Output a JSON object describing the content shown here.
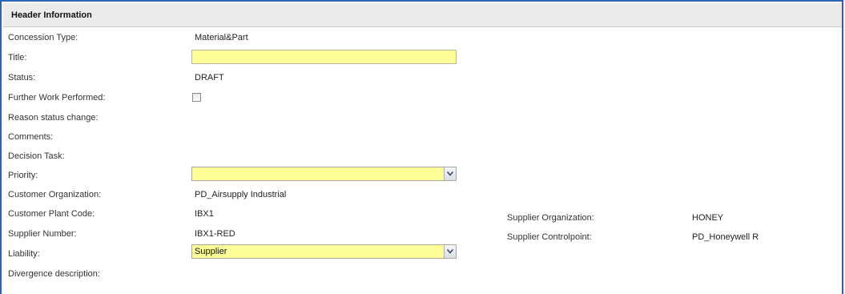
{
  "header": {
    "title": "Header Information"
  },
  "fields": {
    "concession_type": {
      "label": "Concession Type:",
      "value": "Material&Part"
    },
    "title": {
      "label": "Title:",
      "value": ""
    },
    "status": {
      "label": "Status:",
      "value": "DRAFT"
    },
    "further_work": {
      "label": "Further Work Performed:",
      "checked": false
    },
    "reason_status_change": {
      "label": "Reason status change:"
    },
    "comments": {
      "label": "Comments:"
    },
    "decision_task": {
      "label": "Decision Task:"
    },
    "priority": {
      "label": "Priority:",
      "value": ""
    },
    "customer_organization": {
      "label": "Customer Organization:",
      "value": "PD_Airsupply Industrial"
    },
    "customer_plant_code": {
      "label": "Customer Plant Code:",
      "value": "IBX1"
    },
    "supplier_number": {
      "label": "Supplier Number:",
      "value": "IBX1-RED"
    },
    "liability": {
      "label": "Liability:",
      "value": "Supplier"
    },
    "divergence_description": {
      "label": "Divergence description:"
    },
    "supplier_organization": {
      "label": "Supplier Organization:",
      "value": "HONEY"
    },
    "supplier_controlpoint": {
      "label": "Supplier Controlpoint:",
      "value": "PD_Honeywell R"
    }
  },
  "colors": {
    "required_field": "#ffff99",
    "frame_border": "#2b64b6",
    "header_background": "#ebebeb"
  },
  "icons": {
    "dropdown": "chevron-down-icon"
  }
}
